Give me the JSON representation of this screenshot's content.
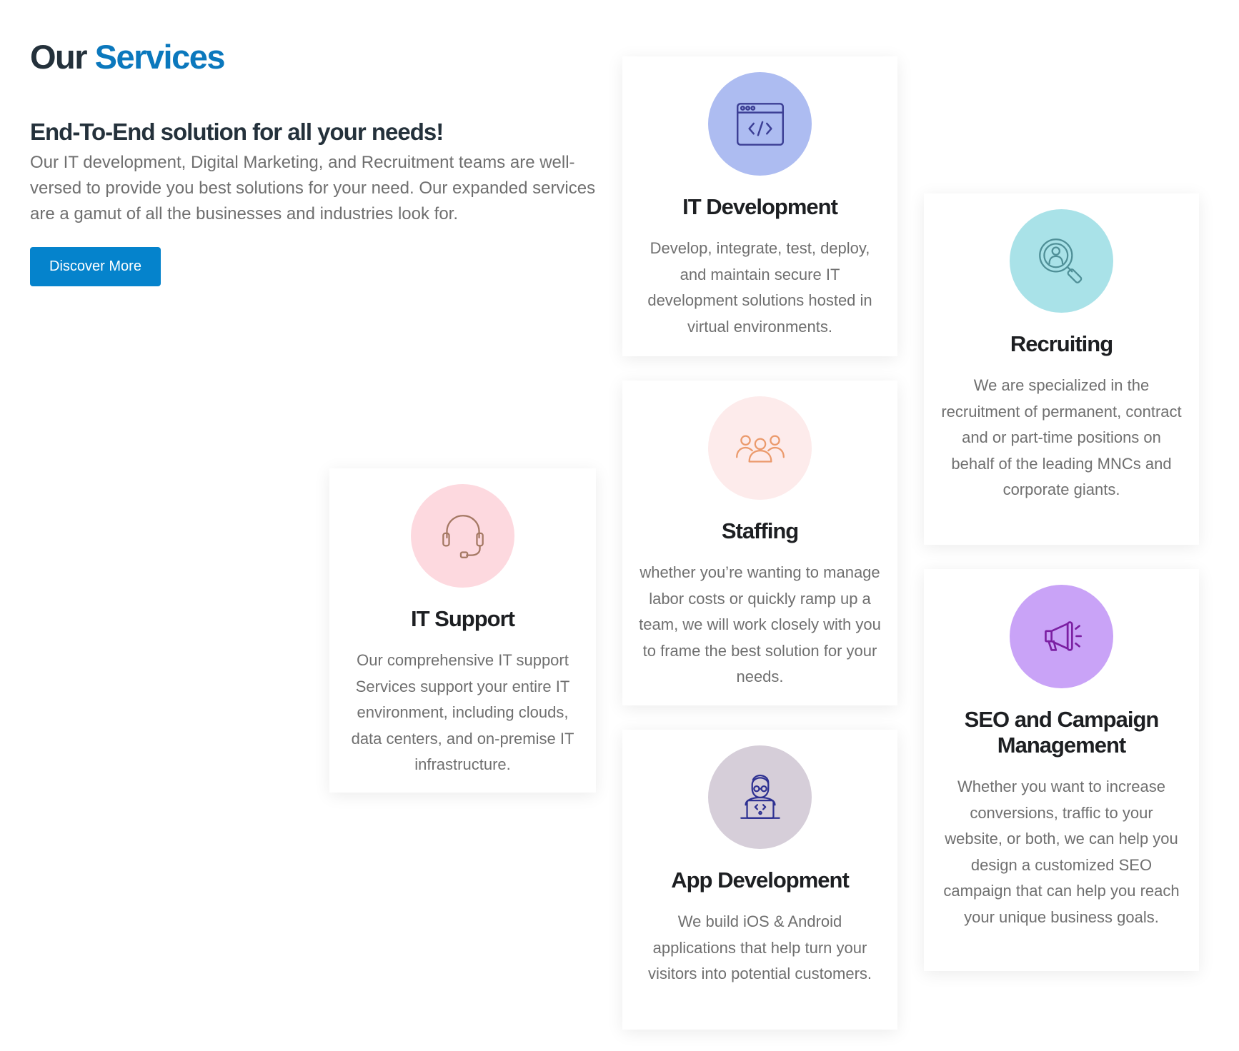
{
  "header": {
    "title_part1": "Our",
    "title_part2": "Services",
    "accent_color": "#0b78bd"
  },
  "intro": {
    "tagline": "End-To-End solution for all your needs!",
    "description": "Our IT development, Digital Marketing, and Recruitment teams are well-versed to provide you best solutions for your need. Our expanded services are a gamut of all the businesses and industries look for.",
    "cta_label": "Discover More",
    "cta_color": "#0583cc"
  },
  "services": {
    "it_development": {
      "title": "IT Development",
      "description": "Develop, integrate, test, deploy, and maintain secure IT development solutions hosted in virtual environments.",
      "icon": "code-window-icon",
      "circle_color": "#adbcf1"
    },
    "recruiting": {
      "title": "Recruiting",
      "description": "We are specialized in the recruitment of permanent, contract and or part-time positions on behalf of the leading MNCs and corporate giants.",
      "icon": "magnifier-person-icon",
      "circle_color": "#a9e2e8"
    },
    "staffing": {
      "title": "Staffing",
      "description": "whether you’re wanting to manage labor costs or quickly ramp up a team, we will work closely with you to frame the best solution for your needs.",
      "icon": "team-icon",
      "circle_color": "#fdebeb"
    },
    "it_support": {
      "title": "IT Support",
      "description": "Our comprehensive IT support Services support your entire IT environment, including clouds, data centers, and on-premise IT infrastructure.",
      "icon": "headset-icon",
      "circle_color": "#fdd9df"
    },
    "seo": {
      "title": "SEO and Campaign Management",
      "description": "Whether you want to increase conversions, traffic to your website, or both, we can help you design a customized SEO campaign that can help you reach your unique business goals.",
      "icon": "megaphone-icon",
      "circle_color": "#c9a3f7"
    },
    "app_development": {
      "title": "App Development",
      "description": "We build iOS & Android applications that help turn your visitors into potential customers.",
      "icon": "developer-laptop-icon",
      "circle_color": "#d6ced9"
    }
  }
}
